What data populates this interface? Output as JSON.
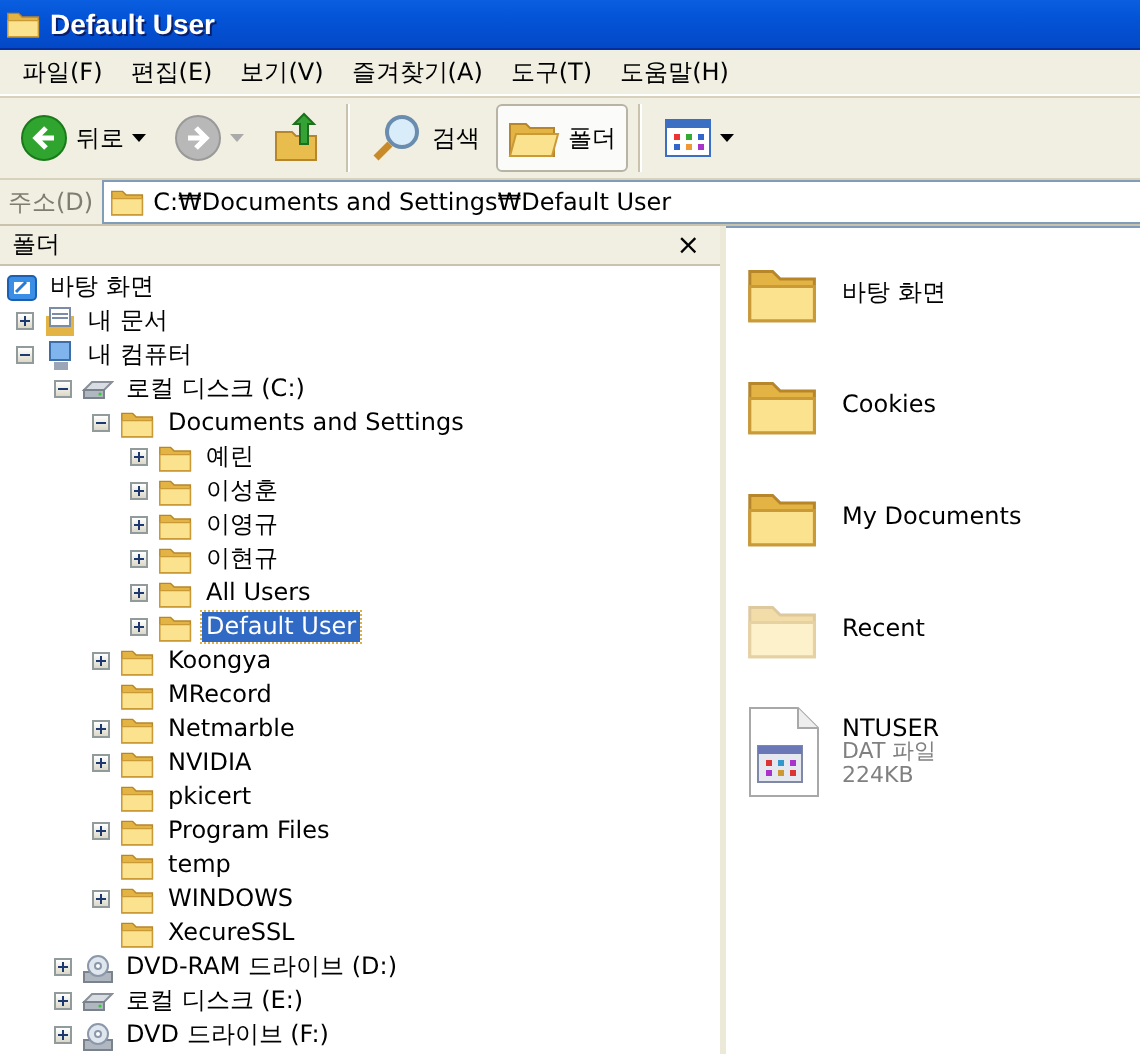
{
  "window": {
    "title": "Default User"
  },
  "menu": [
    "파일(F)",
    "편집(E)",
    "보기(V)",
    "즐겨찾기(A)",
    "도구(T)",
    "도움말(H)"
  ],
  "toolbar": [
    {
      "kind": "back",
      "label": "뒤로",
      "disabled": false
    },
    {
      "kind": "forward",
      "disabled": true
    },
    {
      "kind": "up"
    },
    {
      "kind": "separator"
    },
    {
      "kind": "search",
      "label": "검색"
    },
    {
      "kind": "folders",
      "label": "폴더",
      "selected": true
    },
    {
      "kind": "separator"
    },
    {
      "kind": "views"
    }
  ],
  "address": {
    "label": "주소(D)",
    "value": "C:₩Documents and Settings₩Default User"
  },
  "folder_pane": {
    "title": "폴더",
    "close": "×",
    "tree": [
      {
        "label": "바탕 화면",
        "kind": "desktop",
        "selected": false,
        "children": [
          {
            "label": "내 문서",
            "kind": "documents",
            "expanded": false,
            "selected": false
          },
          {
            "label": "내 컴퓨터",
            "kind": "computer",
            "expanded": true,
            "selected": false,
            "children": [
              {
                "label": "로컬 디스크 (C:)",
                "kind": "drive",
                "expanded": true,
                "selected": false,
                "children": [
                  {
                    "label": "Documents and Settings",
                    "kind": "folder",
                    "expanded": true,
                    "selected": false,
                    "children": [
                      {
                        "label": "예린",
                        "kind": "folder",
                        "expanded": false,
                        "selected": false
                      },
                      {
                        "label": "이성훈",
                        "kind": "folder",
                        "expanded": false,
                        "selected": false
                      },
                      {
                        "label": "이영규",
                        "kind": "folder",
                        "expanded": false,
                        "selected": false
                      },
                      {
                        "label": "이현규",
                        "kind": "folder",
                        "expanded": false,
                        "selected": false
                      },
                      {
                        "label": "All Users",
                        "kind": "folder",
                        "expanded": false,
                        "selected": false
                      },
                      {
                        "label": "Default User",
                        "kind": "folder",
                        "expanded": false,
                        "selected": true
                      }
                    ]
                  },
                  {
                    "label": "Koongya",
                    "kind": "folder",
                    "expanded": false,
                    "selected": false
                  },
                  {
                    "label": "MRecord",
                    "kind": "folder",
                    "selected": false
                  },
                  {
                    "label": "Netmarble",
                    "kind": "folder",
                    "expanded": false,
                    "selected": false
                  },
                  {
                    "label": "NVIDIA",
                    "kind": "folder",
                    "expanded": false,
                    "selected": false
                  },
                  {
                    "label": "pkicert",
                    "kind": "folder",
                    "selected": false
                  },
                  {
                    "label": "Program Files",
                    "kind": "folder",
                    "expanded": false,
                    "selected": false
                  },
                  {
                    "label": "temp",
                    "kind": "folder",
                    "selected": false
                  },
                  {
                    "label": "WINDOWS",
                    "kind": "folder",
                    "expanded": false,
                    "selected": false
                  },
                  {
                    "label": "XecureSSL",
                    "kind": "folder",
                    "selected": false
                  }
                ]
              },
              {
                "label": "DVD-RAM 드라이브 (D:)",
                "kind": "dvd",
                "expanded": false,
                "selected": false
              },
              {
                "label": "로컬 디스크 (E:)",
                "kind": "drive",
                "expanded": false,
                "selected": false
              },
              {
                "label": "DVD 드라이브 (F:)",
                "kind": "dvd",
                "expanded": false,
                "selected": false
              }
            ]
          }
        ]
      }
    ]
  },
  "files": [
    {
      "name": "바탕 화면",
      "kind": "folder",
      "hidden": false
    },
    {
      "name": "Cookies",
      "kind": "folder",
      "hidden": false
    },
    {
      "name": "My Documents",
      "kind": "folder",
      "hidden": false
    },
    {
      "name": "Recent",
      "kind": "folder",
      "hidden": true
    },
    {
      "name": "NTUSER",
      "kind": "file",
      "type": "DAT 파일",
      "size": "224KB"
    }
  ]
}
